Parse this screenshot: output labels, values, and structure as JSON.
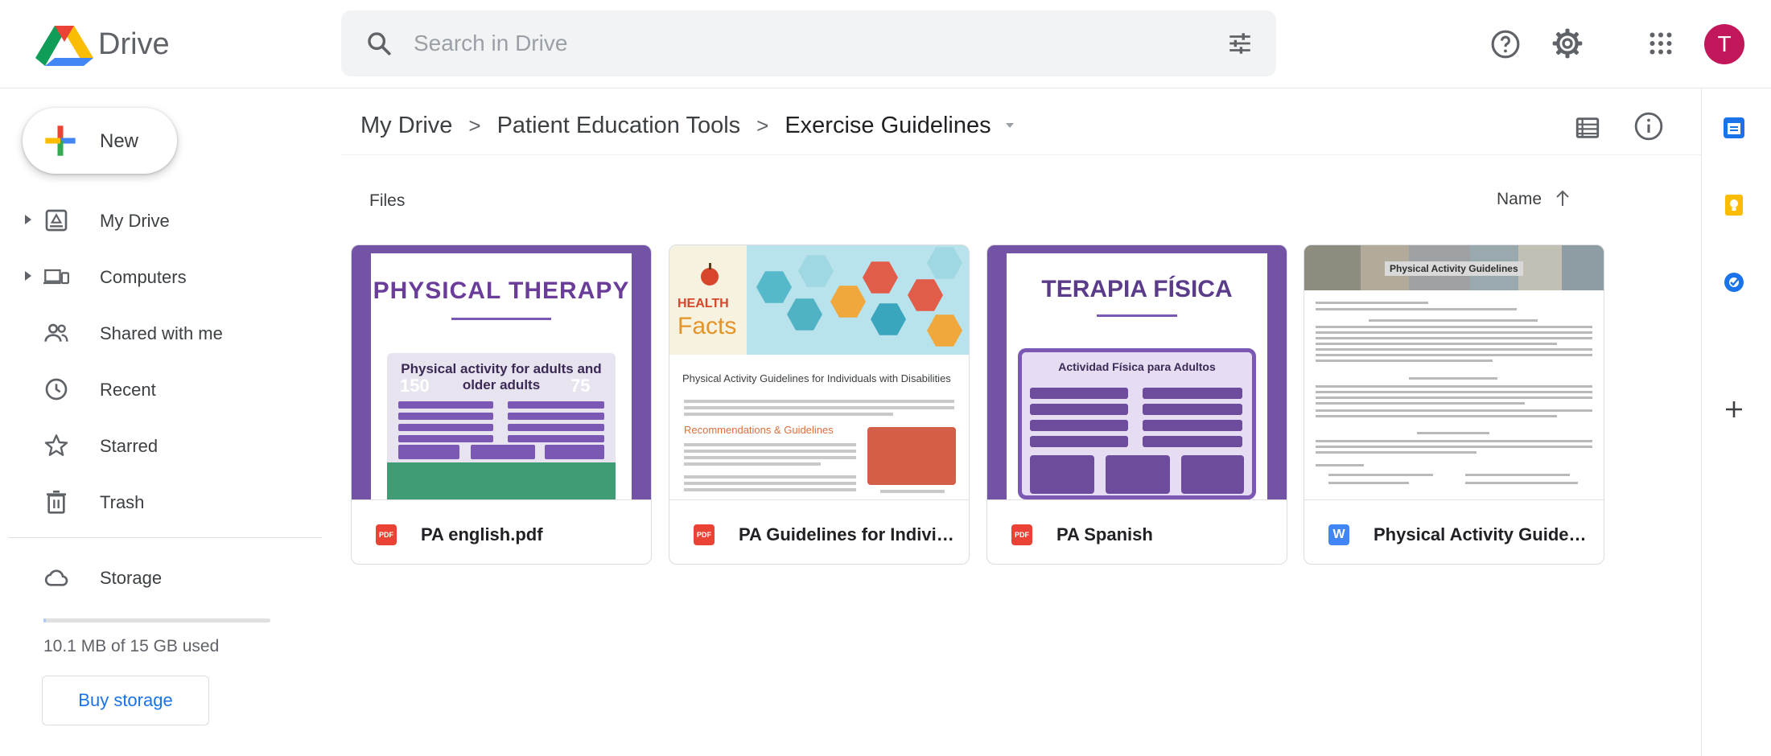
{
  "app": {
    "name": "Drive"
  },
  "search": {
    "placeholder": "Search in Drive"
  },
  "account": {
    "avatar_letter": "T",
    "avatar_color": "#c2185b"
  },
  "sidebar": {
    "new_label": "New",
    "items": [
      {
        "label": "My Drive",
        "icon": "my-drive-icon",
        "expandable": true
      },
      {
        "label": "Computers",
        "icon": "computers-icon",
        "expandable": true
      },
      {
        "label": "Shared with me",
        "icon": "shared-icon",
        "expandable": false
      },
      {
        "label": "Recent",
        "icon": "clock-icon",
        "expandable": false
      },
      {
        "label": "Starred",
        "icon": "star-icon",
        "expandable": false
      },
      {
        "label": "Trash",
        "icon": "trash-icon",
        "expandable": false
      }
    ],
    "storage": {
      "label": "Storage",
      "used_text": "10.1 MB of 15 GB used",
      "used_fraction": 0.0007,
      "buy_label": "Buy storage"
    }
  },
  "breadcrumb": {
    "items": [
      "My Drive",
      "Patient Education Tools",
      "Exercise Guidelines"
    ],
    "separator": ">"
  },
  "files_section": {
    "title": "Files",
    "sort_label": "Name",
    "sort_direction": "ascending"
  },
  "files": [
    {
      "name": "PA english.pdf",
      "type": "pdf",
      "type_label": "PDF"
    },
    {
      "name": "PA Guidelines for Individu...",
      "type": "pdf",
      "type_label": "PDF"
    },
    {
      "name": "PA Spanish",
      "type": "pdf",
      "type_label": "PDF"
    },
    {
      "name": "Physical Activity Guidelin...",
      "type": "doc",
      "type_label": "W"
    }
  ],
  "thumbnails": {
    "pa_english": {
      "title": "PHYSICAL THERAPY",
      "box_title": "Physical activity for adults and older adults",
      "numbers": [
        "150",
        "75"
      ]
    },
    "pa_guidelines": {
      "brand_top": "HEALTH",
      "brand_bottom": "Facts",
      "title": "Physical Activity Guidelines for Individuals with Disabilities",
      "subtitle": "Recommendations & Guidelines"
    },
    "pa_spanish": {
      "title": "TERAPIA FÍSICA",
      "box_title": "Actividad Física para Adultos"
    },
    "pa_doc": {
      "banner": "Physical Activity Guidelines"
    }
  },
  "colors": {
    "accent": "#1a73e8",
    "thumbnail_purple": "#7253a6",
    "pdf_red": "#ea4335",
    "doc_blue": "#4285f4"
  },
  "side_panel": [
    {
      "name": "calendar-app-icon",
      "color": "#1a73e8"
    },
    {
      "name": "keep-app-icon",
      "color": "#fbbc04"
    },
    {
      "name": "tasks-app-icon",
      "color": "#1a73e8"
    }
  ]
}
